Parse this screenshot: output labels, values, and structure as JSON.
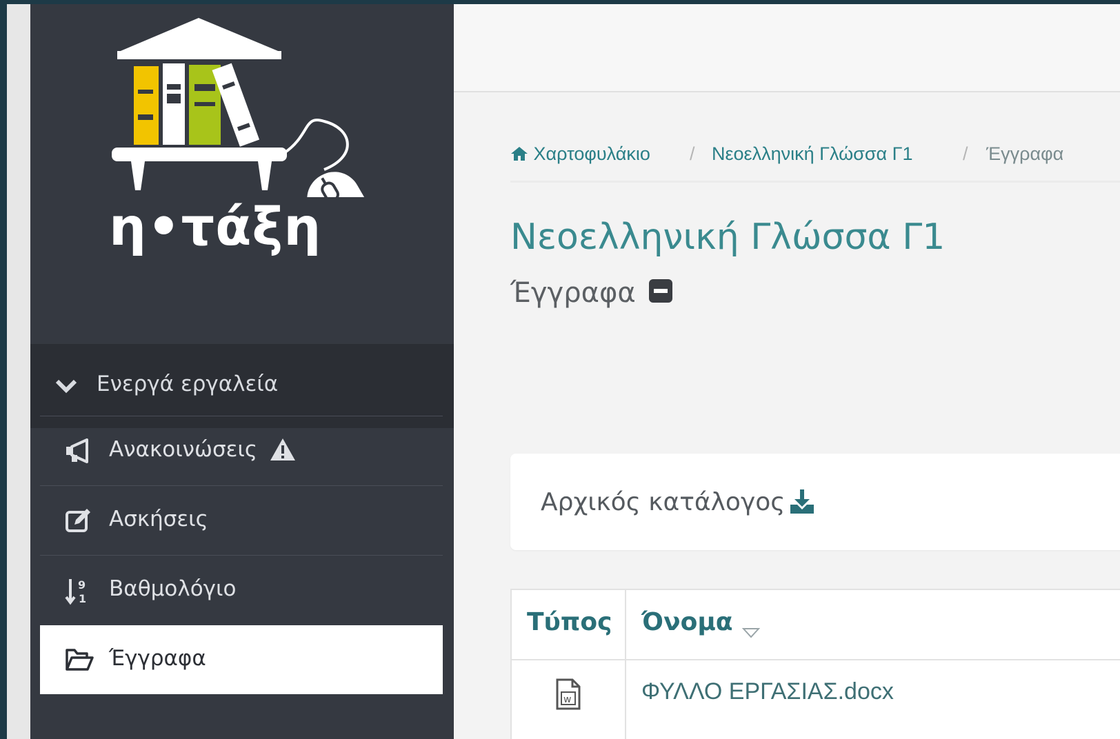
{
  "app": {
    "logo_text": "η•τάξη"
  },
  "sidebar": {
    "tools_header": "Ενεργά εργαλεία",
    "items": [
      {
        "label": "Ανακοινώσεις",
        "icon": "megaphone-icon",
        "warning": true
      },
      {
        "label": "Ασκήσεις",
        "icon": "edit-icon"
      },
      {
        "label": "Βαθμολόγιο",
        "icon": "sort-numeric-icon"
      },
      {
        "label": "Έγγραφα",
        "icon": "folder-open-icon",
        "active": true
      }
    ]
  },
  "breadcrumb": {
    "home": "Χαρτοφυλάκιο",
    "course": "Νεοελληνική Γλώσσα Γ1",
    "current": "Έγγραφα"
  },
  "page": {
    "course_title": "Νεοελληνική Γλώσσα Γ1",
    "subtitle": "Έγγραφα"
  },
  "panel": {
    "label": "Αρχικός κατάλογος"
  },
  "table": {
    "headers": {
      "type": "Τύπος",
      "name": "Όνομα"
    },
    "rows": [
      {
        "type_icon": "word-file-icon",
        "name": "ΦΥΛΛΟ ΕΡΓΑΣΙΑΣ.docx"
      }
    ]
  },
  "colors": {
    "sidebar": "#353941",
    "accent": "#3a8a8f",
    "active_bg": "#ffffff"
  }
}
